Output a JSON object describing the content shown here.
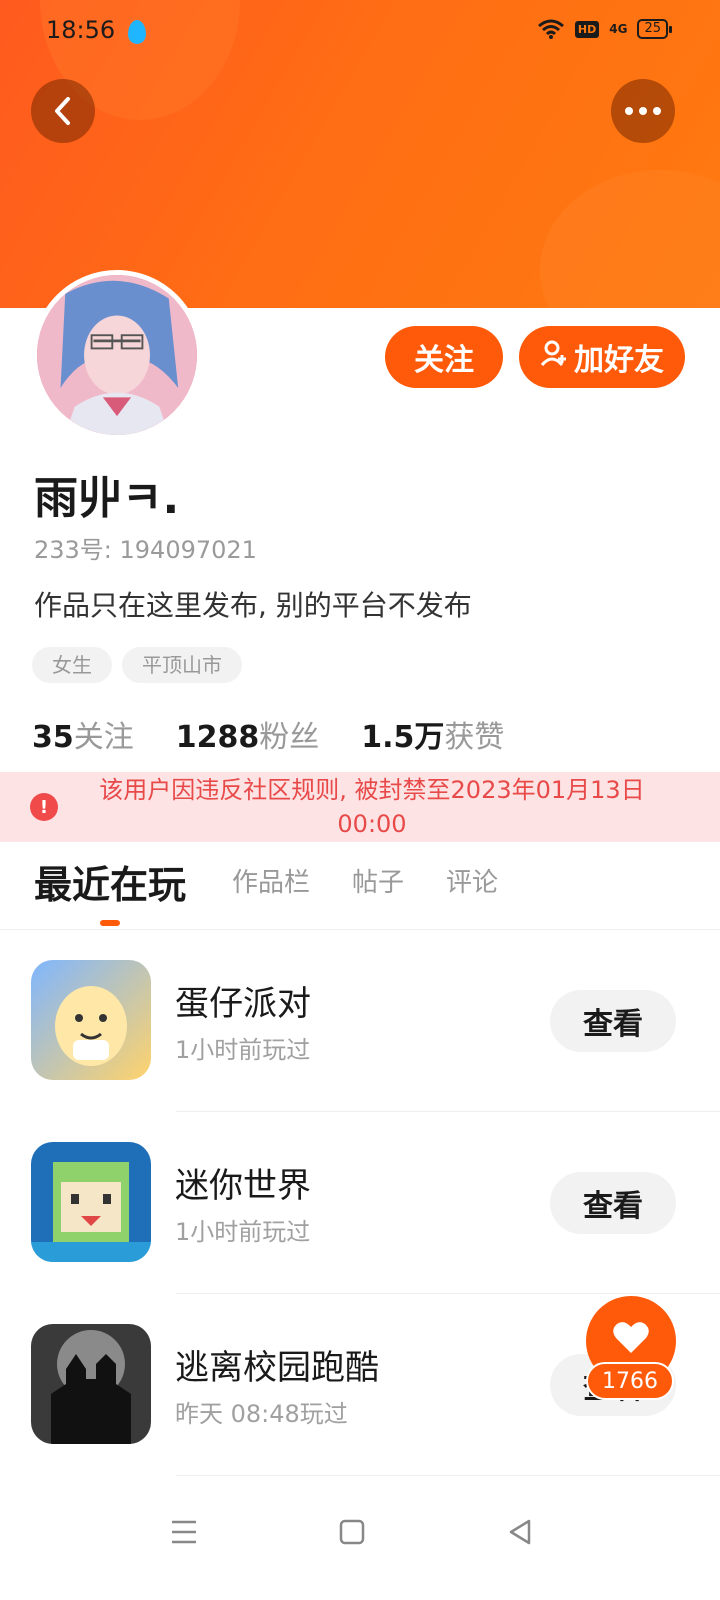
{
  "status_bar": {
    "time": "18:56",
    "network": "4G",
    "hd": "HD",
    "battery": "25"
  },
  "header": {
    "back_icon": "chevron-left-icon",
    "more_icon": "more-dots-icon"
  },
  "profile": {
    "username": "雨丱ㅋ.",
    "uid_text": "233号: 194097021",
    "bio": "作品只在这里发布, 别的平台不发布",
    "tags": [
      "女生",
      "平顶山市"
    ],
    "follow_label": "关注",
    "add_friend_label": "加好友",
    "stats": [
      {
        "value": "35",
        "label": "关注"
      },
      {
        "value": "1288",
        "label": "粉丝"
      },
      {
        "value": "1.5万",
        "label": "获赞"
      }
    ]
  },
  "ban_notice": {
    "text": "该用户因违反社区规则, 被封禁至2023年01月13日 00:00",
    "color": "#e84a4a"
  },
  "tabs": [
    "最近在玩",
    "作品栏",
    "帖子",
    "评论"
  ],
  "games": [
    {
      "name": "蛋仔派对",
      "played": "1小时前玩过",
      "action": "查看"
    },
    {
      "name": "迷你世界",
      "played": "1小时前玩过",
      "action": "查看"
    },
    {
      "name": "逃离校园跑酷",
      "played": "昨天 08:48玩过",
      "action": "查看"
    }
  ],
  "like_fab": {
    "icon": "heart-icon",
    "count": "1766"
  },
  "nav": {
    "menu_icon": "menu-icon",
    "home_icon": "home-square-icon",
    "back_icon": "back-triangle-icon"
  },
  "colors": {
    "accent": "#ff5a0a",
    "banner": "#ff6d14",
    "ban_bg": "#fde3e3"
  }
}
